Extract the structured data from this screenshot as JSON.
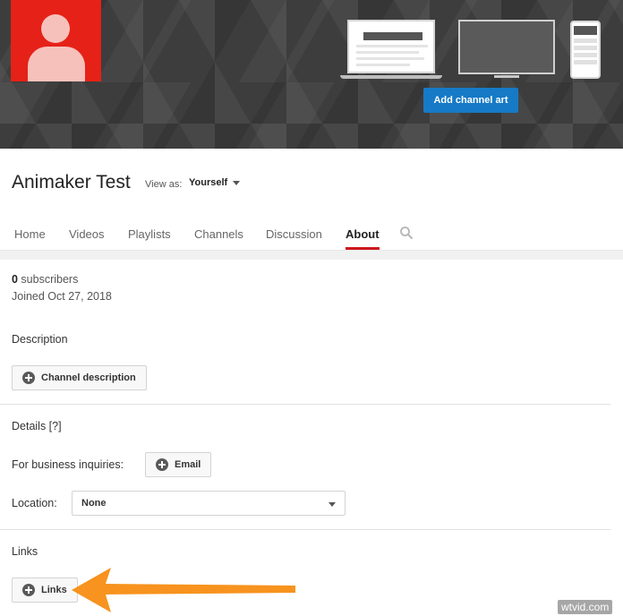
{
  "banner": {
    "add_channel_art_label": "Add channel art"
  },
  "channel": {
    "name": "Animaker Test",
    "view_as_label": "View as:",
    "view_as_value": "Yourself"
  },
  "tabs": [
    {
      "label": "Home"
    },
    {
      "label": "Videos"
    },
    {
      "label": "Playlists"
    },
    {
      "label": "Channels"
    },
    {
      "label": "Discussion"
    },
    {
      "label": "About",
      "active": true
    }
  ],
  "about": {
    "subscribers_count": "0",
    "subscribers_label": " subscribers",
    "joined": "Joined Oct 27, 2018",
    "description_heading": "Description",
    "channel_description_button": "Channel description",
    "details_heading": "Details [?]",
    "business_label": "For business inquiries:",
    "email_button": "Email",
    "location_label": "Location:",
    "location_value": "None",
    "links_heading": "Links",
    "links_button": "Links"
  },
  "colors": {
    "accent_red": "#cc181e",
    "brand_blue": "#167ac6",
    "arrow_orange": "#f7931e"
  },
  "watermark": "wtvid.com"
}
